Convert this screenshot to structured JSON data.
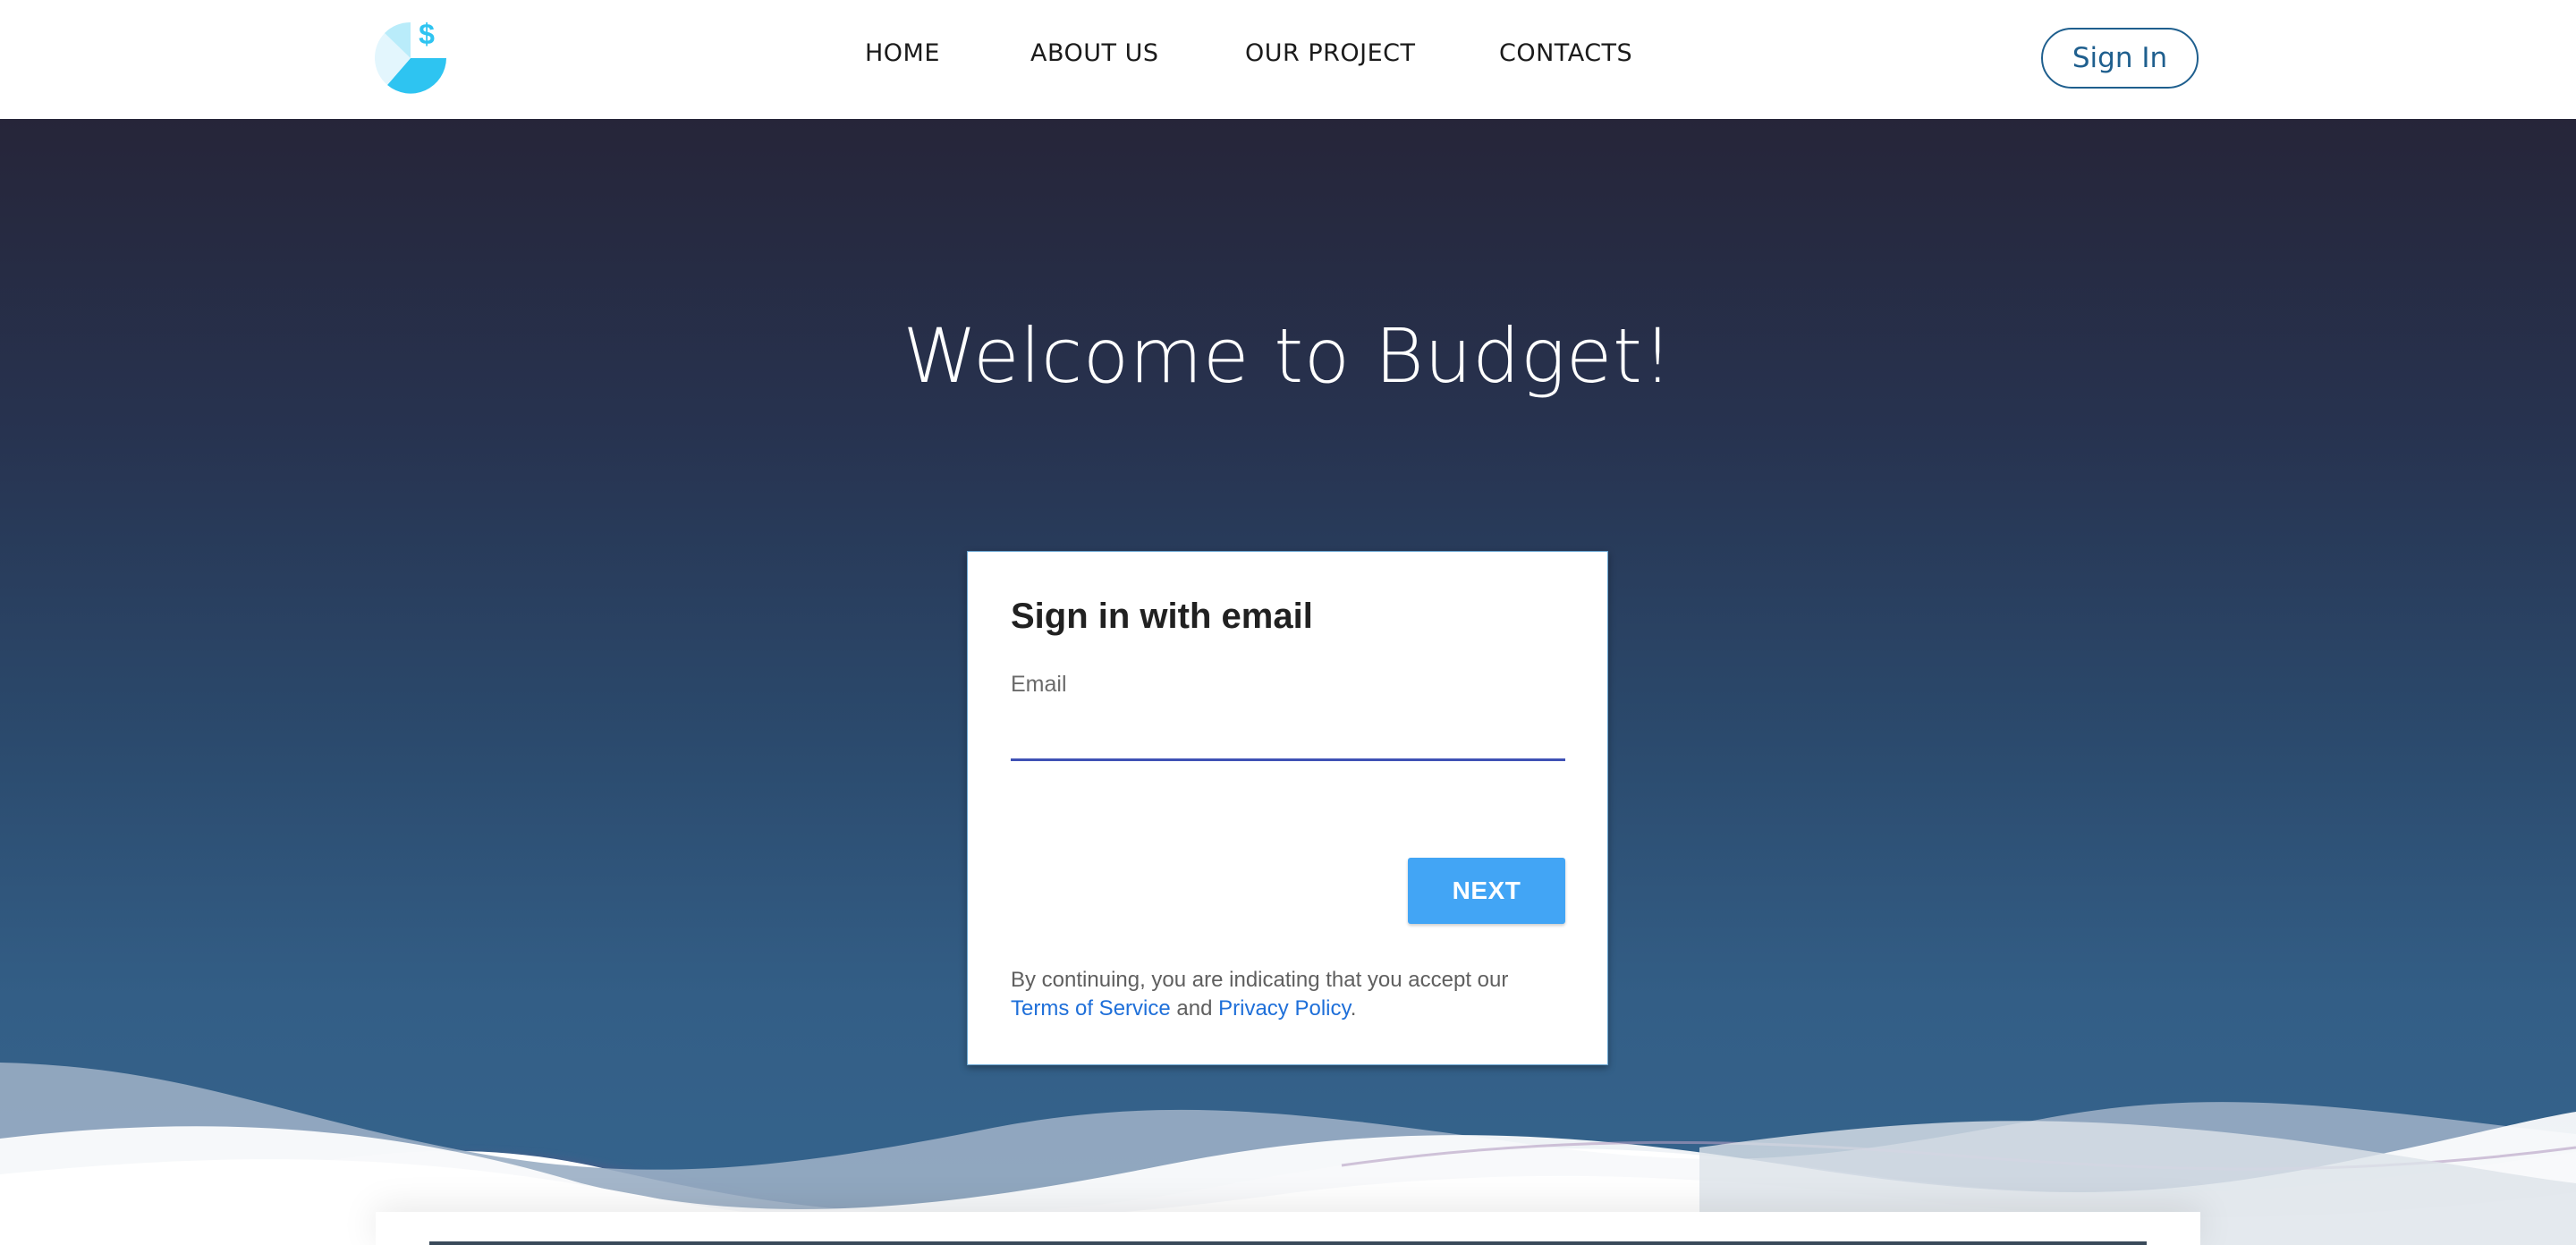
{
  "nav": {
    "links": [
      "HOME",
      "ABOUT US",
      "OUR PROJECT",
      "CONTACTS"
    ],
    "sign_in_label": "Sign In"
  },
  "hero": {
    "title": "Welcome to Budget!"
  },
  "card": {
    "title": "Sign in with email",
    "email_label": "Email",
    "email_value": "",
    "next_label": "NEXT",
    "legal_prefix": "By continuing, you are indicating that you accept our",
    "terms_link": "Terms of Service",
    "legal_and": "and",
    "privacy_link": "Privacy Policy",
    "legal_suffix": "."
  },
  "colors": {
    "accent_blue": "#42a5f5",
    "input_underline": "#3f51b5",
    "link_blue": "#1e6fd9",
    "nav_button_border": "#1f5f8e",
    "logo_light": "#b9ecfa",
    "logo_dark": "#2ec4f1"
  },
  "icons": {
    "logo": "pie-chart-dollar-icon"
  }
}
